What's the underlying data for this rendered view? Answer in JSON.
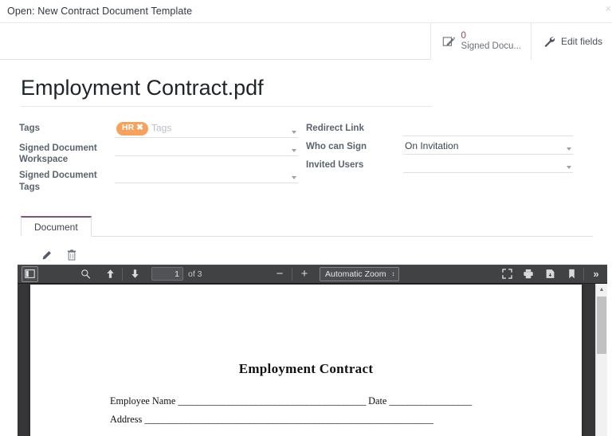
{
  "dialog": {
    "title": "Open: New Contract Document Template",
    "close_label": "×"
  },
  "stat_buttons": [
    {
      "icon": "signature-pencil-icon",
      "count": "0",
      "label": "Signed Docu...",
      "name": "signed-documents-stat-button"
    },
    {
      "icon": "wrench-icon",
      "label": "Edit fields",
      "name": "edit-fields-button"
    }
  ],
  "document": {
    "title": "Employment Contract.pdf"
  },
  "form": {
    "left": [
      {
        "label": "Tags",
        "tag": "HR",
        "tag_remove": "✖",
        "placeholder": "Tags",
        "value": "",
        "has_caret": true,
        "name": "tags-field"
      },
      {
        "label": "Signed Document Workspace",
        "value": "",
        "has_caret": true,
        "name": "signed-document-workspace-field"
      },
      {
        "label": "Signed Document Tags",
        "value": "",
        "has_caret": true,
        "name": "signed-document-tags-field"
      }
    ],
    "right": [
      {
        "label": "Redirect Link",
        "value": "",
        "has_caret": false,
        "name": "redirect-link-field"
      },
      {
        "label": "Who can Sign",
        "value": "On Invitation",
        "has_caret": true,
        "name": "who-can-sign-field"
      },
      {
        "label": "Invited Users",
        "value": "",
        "has_caret": true,
        "name": "invited-users-field"
      }
    ]
  },
  "tabs": [
    {
      "label": "Document",
      "active": true
    }
  ],
  "actions": [
    {
      "icon": "pencil-icon",
      "name": "edit-document-button"
    },
    {
      "icon": "trash-icon",
      "name": "delete-document-button"
    }
  ],
  "pdf_viewer": {
    "toolbar": {
      "sidebar_toggle": "sidebar-toggle-icon",
      "find": "search-icon",
      "previous_page": "arrow-up-icon",
      "next_page": "arrow-down-icon",
      "page_number": "1",
      "page_total": "of 3",
      "zoom_out": "−",
      "zoom_in": "+",
      "zoom_level": "Automatic Zoom",
      "zoom_spinner": "↕",
      "presentation_mode": "fullscreen-icon",
      "print": "printer-icon",
      "download": "download-icon",
      "bookmark": "bookmark-icon",
      "more_tools": "»"
    },
    "page": {
      "heading": "Employment Contract",
      "line1_label_a": "Employee Name",
      "line1_rule_a": "_________________________________________",
      "line1_label_b": "Date",
      "line1_rule_b": "__________________",
      "line2_label": "Address",
      "line2_rule": "_______________________________________________________________"
    }
  },
  "colors": {
    "tag_badge": "#f5a25e",
    "tab_accent": "#7b5a78",
    "stat_count": "#8b4a62",
    "toolbar_bg": "#414244",
    "viewer_bg": "#363639"
  }
}
